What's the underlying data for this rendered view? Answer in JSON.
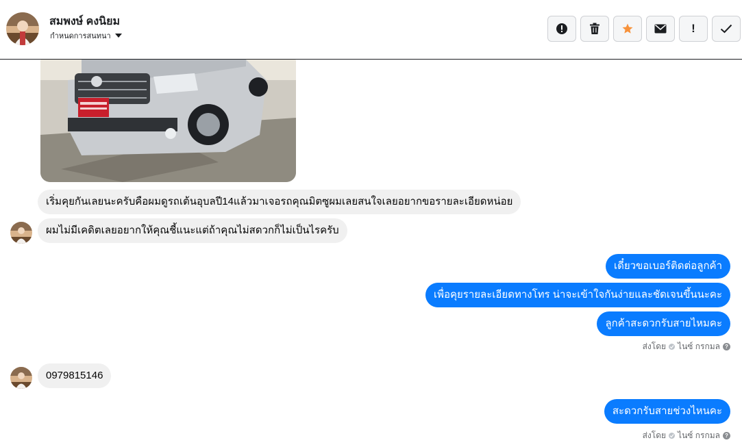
{
  "header": {
    "name": "สมพงษ์ คงนิยม",
    "subtitle": "กำหนดการสนทนา"
  },
  "toolbar": {
    "buttons": [
      {
        "icon": "alert-circle-icon"
      },
      {
        "icon": "trash-icon"
      },
      {
        "icon": "star-icon",
        "color": "#f7923b"
      },
      {
        "icon": "envelope-icon"
      },
      {
        "icon": "exclamation-icon",
        "label": "!"
      },
      {
        "icon": "check-icon"
      }
    ]
  },
  "messages": {
    "in1": "เริ่มคุยกันเลยนะครับคือผมดูรถเต้นอุบลปี14แล้วมาเจอรถคุณมิตซูผมเลยสนใจเลยอยากขอรายละเอียดหน่อย",
    "in2": "ผมไม่มีเคดิตเลยอยากให้คุณชี้แนะแต่ถ้าคุณไม่สดวกก็ไม่เป็นไรครับ",
    "out1": "เดี๋ยวขอเบอร์ติดต่อลูกค้า",
    "out2": "เพื่อคุยรายละเอียดทางโทร น่าจะเข้าใจกันง่ายและชัดเจนขึ้นนะคะ",
    "out3": "ลูกค้าสะดวกรับสายไหมคะ",
    "in3": "0979815146",
    "out4": "สะดวกรับสายช่วงไหนคะ"
  },
  "sent_by": {
    "prefix": "ส่งโดย",
    "agent": "ไนซ์ กรกมล",
    "help": "?"
  },
  "colors": {
    "outgoing_bubble": "#0a7cff",
    "incoming_bubble": "#f0f0f0"
  }
}
